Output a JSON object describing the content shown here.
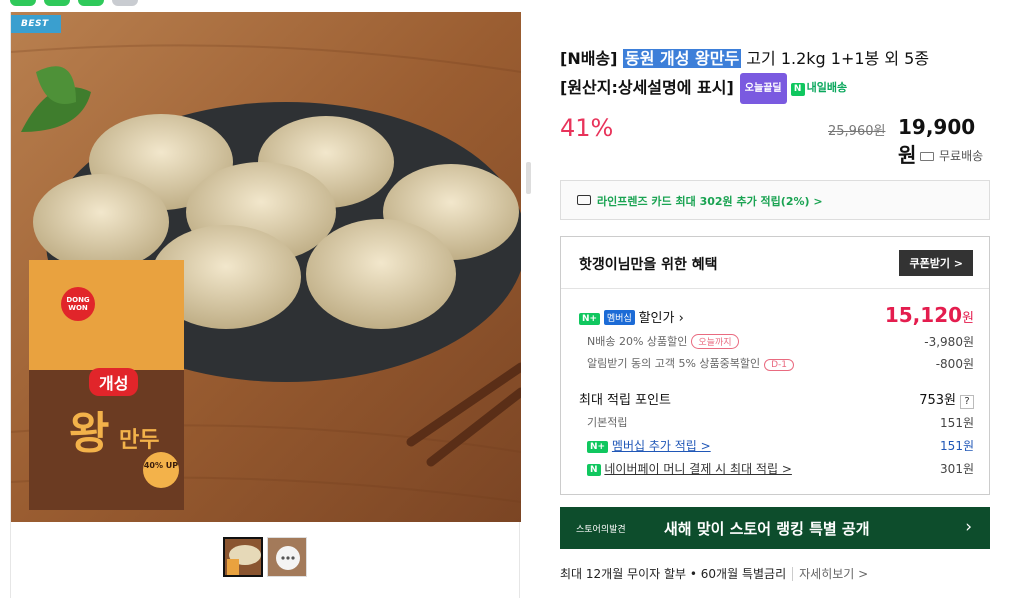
{
  "badge": "BEST",
  "title": {
    "prefix": "[N배송] ",
    "highlight": "동원 개성 왕만두",
    "rest": " 고기 1.2kg 1+1봉 외 5종",
    "line2": "[원산지:상세설명에 표시]",
    "tag_today": "오늘끝딜",
    "tag_delivery_icon": "N",
    "tag_delivery": "내일배송"
  },
  "price": {
    "discount": "41%",
    "original": "25,960원",
    "current": "19,900원",
    "shipping": "무료배송"
  },
  "card_promo": "라인프렌즈 카드 최대 302원 추가 적립(2%) >",
  "benefit": {
    "heading": "핫갱이님만을 위한 혜택",
    "coupon_button": "쿠폰받기 >",
    "sale_label": "할인가",
    "sale_badge_n": "N+",
    "sale_badge_mem": "멤버십",
    "sale_price": "15,120",
    "sale_unit": "원",
    "n_delivery": "N배송 20% 상품할인",
    "n_delivery_pill": "오늘까지",
    "n_delivery_amount": "-3,980원",
    "alarm": "알림받기 동의 고객 5% 상품중복할인",
    "alarm_pill": "D-1",
    "alarm_amount": "-800원",
    "points_label": "최대 적립 포인트",
    "points_value": "753원",
    "points_help": "?",
    "basic_label": "기본적립",
    "basic_value": "151원",
    "member_label": "멤버십 추가 적립 >",
    "member_value": "151원",
    "pay_label": "네이버페이 머니 결제 시 최대 적립 >",
    "pay_value": "301원"
  },
  "banner": {
    "small": "스토어의발견",
    "main": "새해 맞이 스토어 랭킹 특별 공개",
    "arrow": "›"
  },
  "installment": {
    "text": "최대 12개월 무이자 할부 • 60개월 특별금리",
    "more": "자세히보기 >"
  },
  "package": {
    "brand": "DONG WON",
    "name1": "개성",
    "name2": "왕",
    "name3": "만두",
    "promo": "40% UP"
  }
}
